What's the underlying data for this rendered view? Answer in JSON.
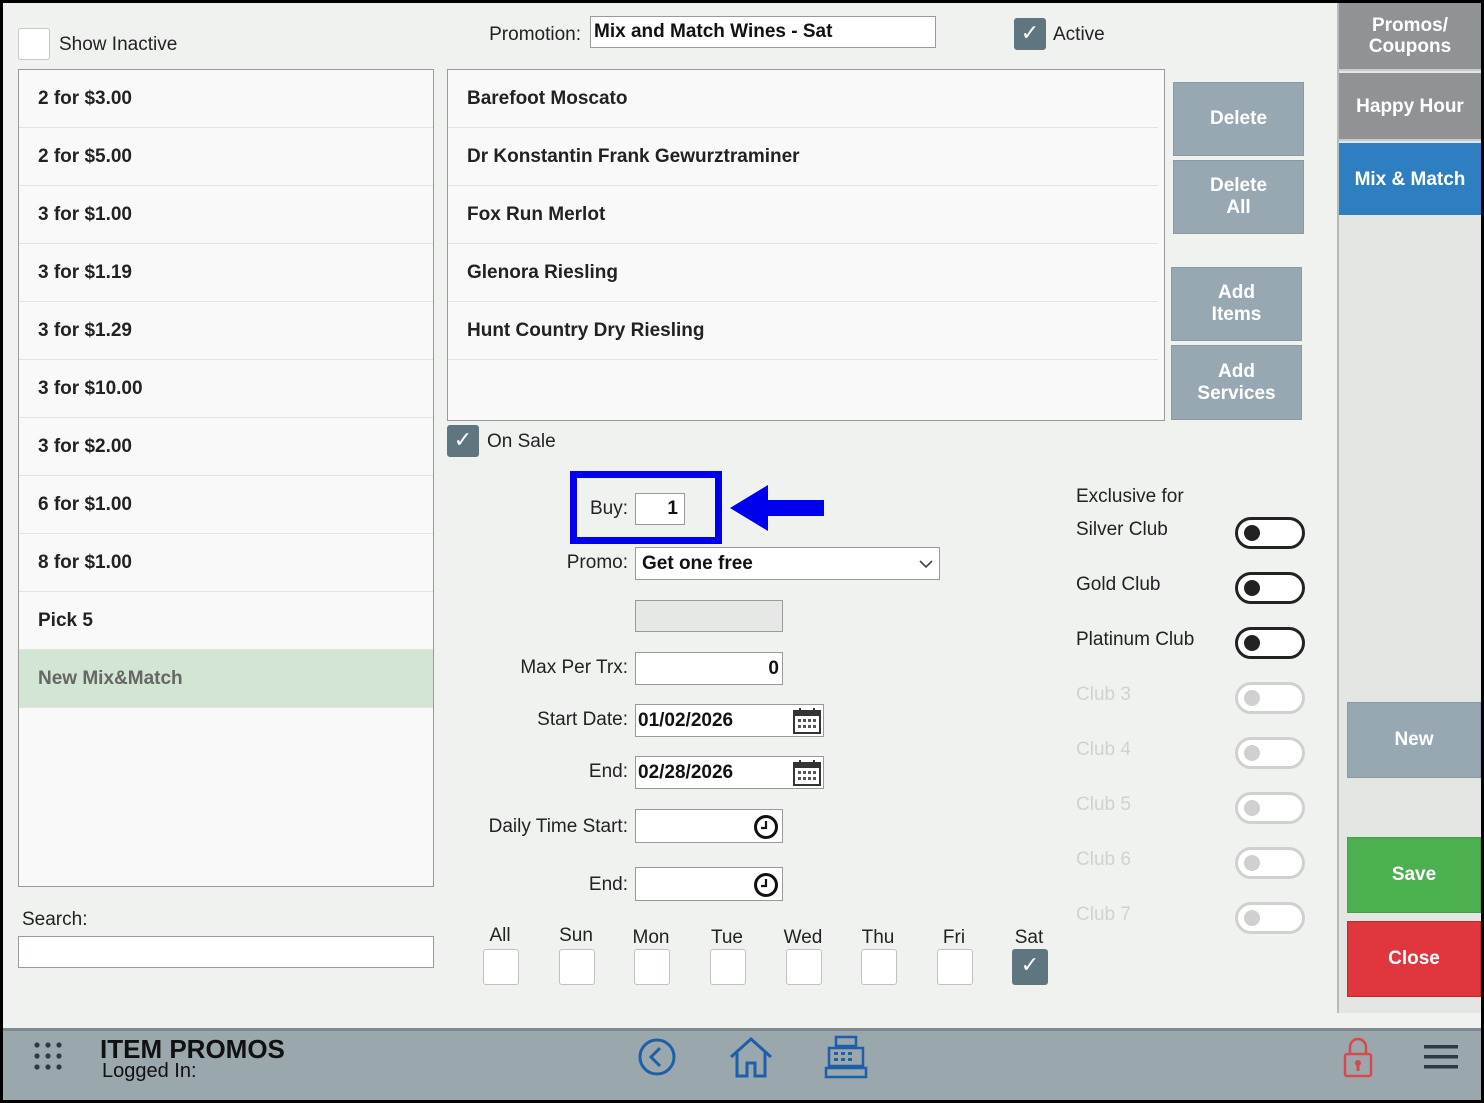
{
  "header": {
    "show_inactive_label": "Show Inactive",
    "promotion_label": "Promotion:",
    "promotion_value": "Mix and Match Wines - Sat",
    "active_label": "Active"
  },
  "promo_list": {
    "items": [
      {
        "label": "2 for $3.00"
      },
      {
        "label": "2 for $5.00"
      },
      {
        "label": "3 for $1.00"
      },
      {
        "label": "3 for $1.19"
      },
      {
        "label": "3 for $1.29"
      },
      {
        "label": "3 for $10.00"
      },
      {
        "label": "3 for $2.00"
      },
      {
        "label": "6 for $1.00"
      },
      {
        "label": "8 for $1.00"
      },
      {
        "label": "Pick 5"
      },
      {
        "label": "New Mix&Match"
      }
    ],
    "search_label": "Search:",
    "search_value": ""
  },
  "items_list": {
    "items": [
      {
        "label": "Barefoot Moscato"
      },
      {
        "label": "Dr Konstantin Frank Gewurztraminer"
      },
      {
        "label": "Fox Run Merlot"
      },
      {
        "label": "Glenora Riesling"
      },
      {
        "label": "Hunt Country Dry Riesling"
      }
    ]
  },
  "item_buttons": {
    "delete": "Delete",
    "delete_all_1": "Delete",
    "delete_all_2": "All",
    "add_items_1": "Add",
    "add_items_2": "Items",
    "add_services_1": "Add",
    "add_services_2": "Services"
  },
  "form": {
    "on_sale_label": "On Sale",
    "buy_label": "Buy:",
    "buy_value": "1",
    "promo_label": "Promo:",
    "promo_value": "Get one free",
    "max_label": "Max Per Trx:",
    "max_value": "0",
    "start_label": "Start Date:",
    "start_value": "01/02/2026",
    "end_label": "End:",
    "end_value": "02/28/2026",
    "time_start_label": "Daily Time Start:",
    "time_end_label": "End:"
  },
  "days": [
    {
      "label": "All",
      "checked": false
    },
    {
      "label": "Sun",
      "checked": false
    },
    {
      "label": "Mon",
      "checked": false
    },
    {
      "label": "Tue",
      "checked": false
    },
    {
      "label": "Wed",
      "checked": false
    },
    {
      "label": "Thu",
      "checked": false
    },
    {
      "label": "Fri",
      "checked": false
    },
    {
      "label": "Sat",
      "checked": true
    }
  ],
  "clubs": {
    "exclusive_label": "Exclusive for",
    "items": [
      {
        "label": "Silver Club",
        "enabled": true
      },
      {
        "label": "Gold Club",
        "enabled": true
      },
      {
        "label": "Platinum Club",
        "enabled": true
      },
      {
        "label": "Club 3",
        "enabled": false
      },
      {
        "label": "Club 4",
        "enabled": false
      },
      {
        "label": "Club 5",
        "enabled": false
      },
      {
        "label": "Club 6",
        "enabled": false
      },
      {
        "label": "Club 7",
        "enabled": false
      }
    ]
  },
  "sidebar": {
    "promos_1": "Promos/",
    "promos_2": "Coupons",
    "happy_hour": "Happy Hour",
    "mix_match": "Mix & Match",
    "new": "New",
    "save": "Save",
    "close": "Close"
  },
  "footer": {
    "title": "ITEM PROMOS",
    "logged_in": "Logged In:"
  },
  "colors": {
    "accent_blue": "#2e7fc2",
    "save_green": "#4caf50",
    "close_red": "#e0363d",
    "highlight_box": "#0000ee"
  }
}
